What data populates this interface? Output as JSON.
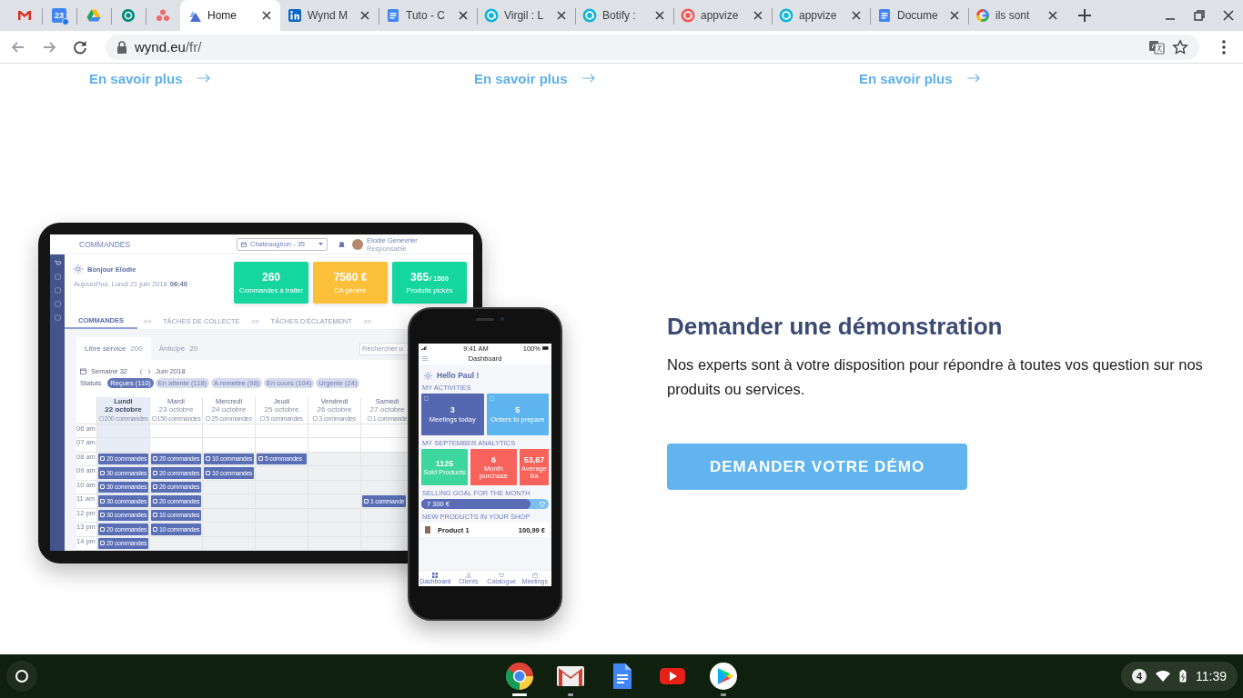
{
  "browser": {
    "tabs": [
      {
        "kind": "pinned",
        "selected": false
      },
      {
        "kind": "pinned",
        "badge": "23",
        "selected": false
      },
      {
        "kind": "pinned",
        "selected": false
      },
      {
        "kind": "pinned",
        "selected": false
      },
      {
        "kind": "pinned",
        "selected": false
      },
      {
        "kind": "normal",
        "title": "Home",
        "selected": true
      },
      {
        "kind": "normal",
        "title": "Wynd M",
        "selected": false
      },
      {
        "kind": "normal",
        "title": "Tuto - C",
        "selected": false
      },
      {
        "kind": "normal",
        "title": "Virgil : L",
        "selected": false
      },
      {
        "kind": "normal",
        "title": "Botify : ",
        "selected": false
      },
      {
        "kind": "normal",
        "title": "appvize",
        "selected": false
      },
      {
        "kind": "normal",
        "title": "appvize",
        "selected": false
      },
      {
        "kind": "normal",
        "title": "Docume",
        "selected": false
      },
      {
        "kind": "normal",
        "title": "ils sont",
        "selected": false
      }
    ],
    "address": {
      "host": "wynd.eu",
      "path": "/fr/"
    }
  },
  "page": {
    "links": [
      "En savoir plus",
      "En savoir plus",
      "En savoir plus"
    ],
    "demo": {
      "heading": "Demander une démonstration",
      "text": "Nos experts sont à votre disposition pour répondre à toutes vos question sur nos produits ou services.",
      "button": "DEMANDER VOTRE DÉMO"
    },
    "tablet": {
      "title": "COMMANDES",
      "store": "Chateaugiron - 35",
      "user_name": "Elodie Genevrier",
      "user_role": "Responsable",
      "greeting": "Bonjour Elodie",
      "date": "Aujourd'hui, Lundi 21 juin 2018",
      "time": "06:40",
      "stats": [
        {
          "value": "260",
          "label": "Commandes à traiter",
          "color": "#16d6a0"
        },
        {
          "value": "7560 €",
          "label": "CA généré",
          "color": "#fbbf3a"
        },
        {
          "value": "365",
          "suffix": "/ 1500",
          "label": "Produits pickés",
          "color": "#16d6a0"
        }
      ],
      "steps": [
        {
          "label": "COMMANDES",
          "next": ">>",
          "selected": true
        },
        {
          "label": "TÂCHES DE COLLECTE",
          "next": ">>",
          "selected": false
        },
        {
          "label": "TÂCHES D'ÉCLATEMENT",
          "next": ">>",
          "selected": false
        }
      ],
      "subtabs": [
        {
          "label": "Libre service",
          "count": "200",
          "selected": true
        },
        {
          "label": "Anticipé",
          "count": "20",
          "selected": false
        }
      ],
      "search_placeholder": "Rechercher u",
      "week": "Semaine 32",
      "month": "Juin 2018",
      "status_label": "Statuts",
      "statuses": [
        {
          "label": "Reçues (110)",
          "selected": true
        },
        {
          "label": "En attente (118)",
          "selected": false
        },
        {
          "label": "A remettre (98)",
          "selected": false
        },
        {
          "label": "En cours (104)",
          "selected": false
        },
        {
          "label": "Urgente (24)",
          "selected": false
        }
      ],
      "times": [
        "06 am",
        "07 am",
        "08 am",
        "09 am",
        "10 am",
        "11 am",
        "12 pm",
        "13 pm",
        "14 pm"
      ],
      "days": [
        {
          "name": "Lundi",
          "date": "22 octobre",
          "count": "200 commandes",
          "selected": true,
          "slots": [
            {
              "filled": false
            },
            {
              "filled": false
            },
            {
              "filled": true,
              "label": "20 commandes"
            },
            {
              "filled": true,
              "label": "30 commandes"
            },
            {
              "filled": true,
              "label": "30 commandes"
            },
            {
              "filled": true,
              "label": "30 commandes"
            },
            {
              "filled": true,
              "label": "30 commandes"
            },
            {
              "filled": true,
              "label": "20 commandes"
            },
            {
              "filled": true,
              "label": "20 commandes"
            }
          ]
        },
        {
          "name": "Mardi",
          "date": "23 octobre",
          "count": "150 commandes",
          "selected": false,
          "slots": [
            {
              "filled": false
            },
            {
              "filled": false
            },
            {
              "filled": true,
              "label": "20 commandes"
            },
            {
              "filled": true,
              "label": "20 commandes"
            },
            {
              "filled": true,
              "label": "20 commandes"
            },
            {
              "filled": true,
              "label": "20 commandes"
            },
            {
              "filled": true,
              "label": "10 commandes"
            },
            {
              "filled": true,
              "label": "10 commandes"
            },
            {
              "filled": false
            }
          ]
        },
        {
          "name": "Mercredi",
          "date": "24 octobre",
          "count": "25 commandes",
          "selected": false,
          "slots": [
            {
              "filled": false
            },
            {
              "filled": false
            },
            {
              "filled": true,
              "label": "10 commandes"
            },
            {
              "filled": true,
              "label": "10 commandes"
            },
            {
              "filled": false
            },
            {
              "filled": false
            },
            {
              "filled": false
            },
            {
              "filled": false
            },
            {
              "filled": false
            }
          ]
        },
        {
          "name": "Jeudi",
          "date": "25 octobre",
          "count": "5 commandes",
          "selected": false,
          "slots": [
            {
              "filled": false
            },
            {
              "filled": false
            },
            {
              "filled": true,
              "label": "5 commandes"
            },
            {
              "filled": false
            },
            {
              "filled": false
            },
            {
              "filled": false
            },
            {
              "filled": false
            },
            {
              "filled": false
            },
            {
              "filled": false
            }
          ]
        },
        {
          "name": "Vendredi",
          "date": "26 octobre",
          "count": "3 commandes",
          "selected": false,
          "slots": [
            {
              "filled": false
            },
            {
              "filled": false
            },
            {
              "filled": false
            },
            {
              "filled": false
            },
            {
              "filled": false
            },
            {
              "filled": false
            },
            {
              "filled": false
            },
            {
              "filled": false
            },
            {
              "filled": false
            }
          ]
        },
        {
          "name": "Samedi",
          "date": "27 octobre",
          "count": "1 commande",
          "selected": false,
          "slots": [
            {
              "filled": false
            },
            {
              "filled": false
            },
            {
              "filled": false
            },
            {
              "filled": false
            },
            {
              "filled": false
            },
            {
              "filled": true,
              "label": "1 commande"
            },
            {
              "filled": false
            },
            {
              "filled": false
            },
            {
              "filled": false
            }
          ]
        }
      ]
    },
    "phone": {
      "clock": "9:41 AM",
      "battery": "100%",
      "title": "Dashboard",
      "greeting": "Hello Paul !",
      "activities_label": "MY ACTIVITIES",
      "activities": [
        {
          "value": "3",
          "label": "Meetings today",
          "color": "#5567b0"
        },
        {
          "value": "5",
          "label": "Orders to prepare",
          "color": "#5eb4ef"
        }
      ],
      "analytics_label": "MY SEPTEMBER ANALYTICS",
      "analytics": [
        {
          "value": "1125",
          "label": "Sold Products",
          "color": "#3cd69e"
        },
        {
          "value": "6",
          "label": "Month purchase",
          "color": "#f7625a"
        },
        {
          "value": "53,67",
          "label": "Average Ba",
          "color": "#f7625a"
        }
      ],
      "goal_label": "SELLING GOAL FOR THE MONTH",
      "goal": {
        "reading": "7 300 €",
        "level": 0.86
      },
      "products_label": "NEW PRODUCTS IN YOUR SHOP",
      "products": [
        {
          "name": "Product 1",
          "price": "100,99 €"
        }
      ],
      "nav": [
        {
          "label": "Dashboard",
          "selected": true
        },
        {
          "label": "Clients",
          "selected": false
        },
        {
          "label": "Catalogue",
          "selected": false
        },
        {
          "label": "Meetings",
          "selected": false
        }
      ]
    }
  },
  "shelf": {
    "apps": [
      {
        "running": true,
        "focused": true
      },
      {
        "running": true,
        "focused": false
      },
      {
        "running": false
      },
      {
        "running": false
      },
      {
        "running": true,
        "focused": false
      }
    ],
    "notifications": "4",
    "time": "11:39"
  }
}
